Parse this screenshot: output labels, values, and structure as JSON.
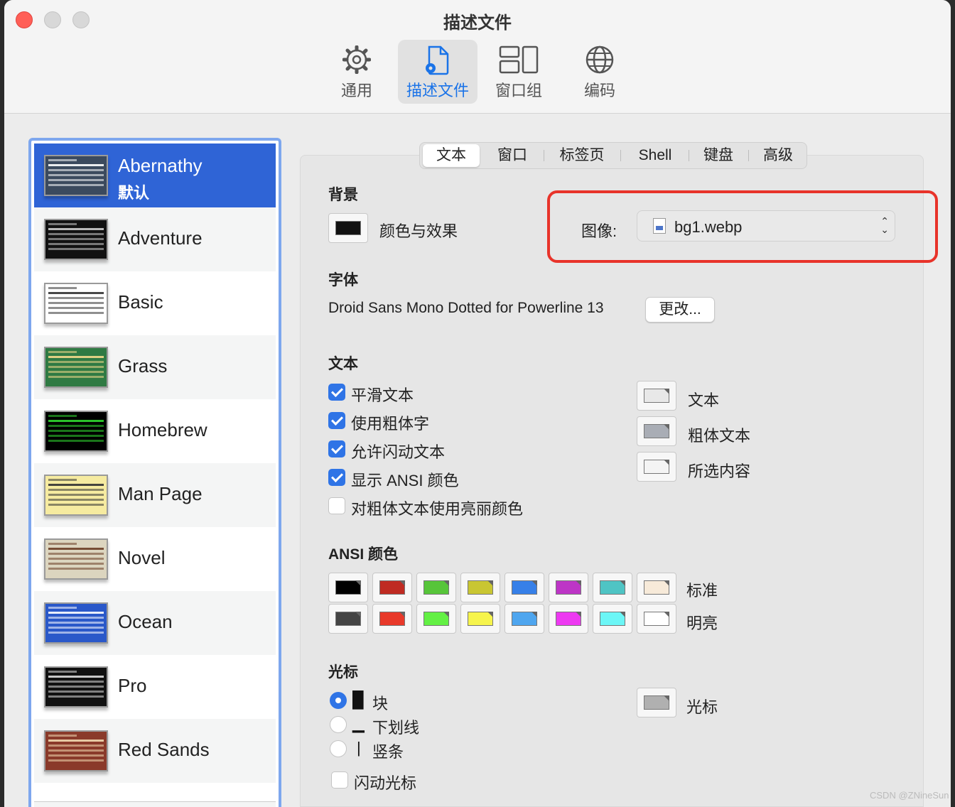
{
  "window": {
    "title": "描述文件"
  },
  "toolbar": {
    "items": [
      {
        "label": "通用",
        "icon": "gear-icon"
      },
      {
        "label": "描述文件",
        "icon": "profile-icon"
      },
      {
        "label": "窗口组",
        "icon": "window-groups-icon"
      },
      {
        "label": "编码",
        "icon": "globe-icon"
      }
    ],
    "active": "描述文件"
  },
  "profiles": {
    "selected": "Abernathy",
    "default_label": "默认",
    "items": [
      {
        "name": "Abernathy",
        "bg": "#3b4a5e",
        "fg": "#ffffff"
      },
      {
        "name": "Adventure",
        "bg": "#111111",
        "fg": "#cccccc"
      },
      {
        "name": "Basic",
        "bg": "#ffffff",
        "fg": "#333333"
      },
      {
        "name": "Grass",
        "bg": "#2f7a43",
        "fg": "#f2d98b"
      },
      {
        "name": "Homebrew",
        "bg": "#000000",
        "fg": "#2fd62f"
      },
      {
        "name": "Man Page",
        "bg": "#f6eba0",
        "fg": "#333333"
      },
      {
        "name": "Novel",
        "bg": "#dcd5bf",
        "fg": "#6b3e26"
      },
      {
        "name": "Ocean",
        "bg": "#2a58c9",
        "fg": "#ffffff"
      },
      {
        "name": "Pro",
        "bg": "#111111",
        "fg": "#dddddd"
      },
      {
        "name": "Red Sands",
        "bg": "#8a3a2a",
        "fg": "#f0d9b0"
      }
    ]
  },
  "tabs": {
    "items": [
      "文本",
      "窗口",
      "标签页",
      "Shell",
      "键盘",
      "高级"
    ],
    "active": "文本"
  },
  "background": {
    "title": "背景",
    "color_effects_label": "颜色与效果",
    "color": "#111111",
    "image_label": "图像:",
    "image_value": "bg1.webp"
  },
  "font": {
    "title": "字体",
    "value": "Droid Sans Mono Dotted for Powerline 13",
    "change_label": "更改..."
  },
  "text": {
    "title": "文本",
    "options": [
      {
        "label": "平滑文本",
        "checked": true
      },
      {
        "label": "使用粗体字",
        "checked": true
      },
      {
        "label": "允许闪动文本",
        "checked": true
      },
      {
        "label": "显示 ANSI 颜色",
        "checked": true
      },
      {
        "label": "对粗体文本使用亮丽颜色",
        "checked": false
      }
    ],
    "colors": [
      {
        "label": "文本",
        "color": "#e8e8e8"
      },
      {
        "label": "粗体文本",
        "color": "#a9adb5"
      },
      {
        "label": "所选内容",
        "color": "#f4f4f4"
      }
    ]
  },
  "ansi": {
    "title": "ANSI 颜色",
    "normal_label": "标准",
    "bright_label": "明亮",
    "normal": [
      "#000000",
      "#bf2b22",
      "#57c53a",
      "#c9c632",
      "#3780e8",
      "#bd35c6",
      "#4fc4c4",
      "#f7ead9"
    ],
    "bright": [
      "#444444",
      "#e8392a",
      "#63f044",
      "#f6f44c",
      "#4fa6ef",
      "#ed39f1",
      "#6cf6f6",
      "#ffffff"
    ]
  },
  "cursor": {
    "title": "光标",
    "options": [
      {
        "glyph": "█",
        "label": "块",
        "selected": true
      },
      {
        "glyph": "▁",
        "label": "下划线",
        "selected": false
      },
      {
        "glyph": "|",
        "label": "竖条",
        "selected": false
      }
    ],
    "blink_label": "闪动光标",
    "blink": false,
    "color_label": "光标",
    "color": "#b0b0b0"
  },
  "watermark": "CSDN @ZNineSun"
}
